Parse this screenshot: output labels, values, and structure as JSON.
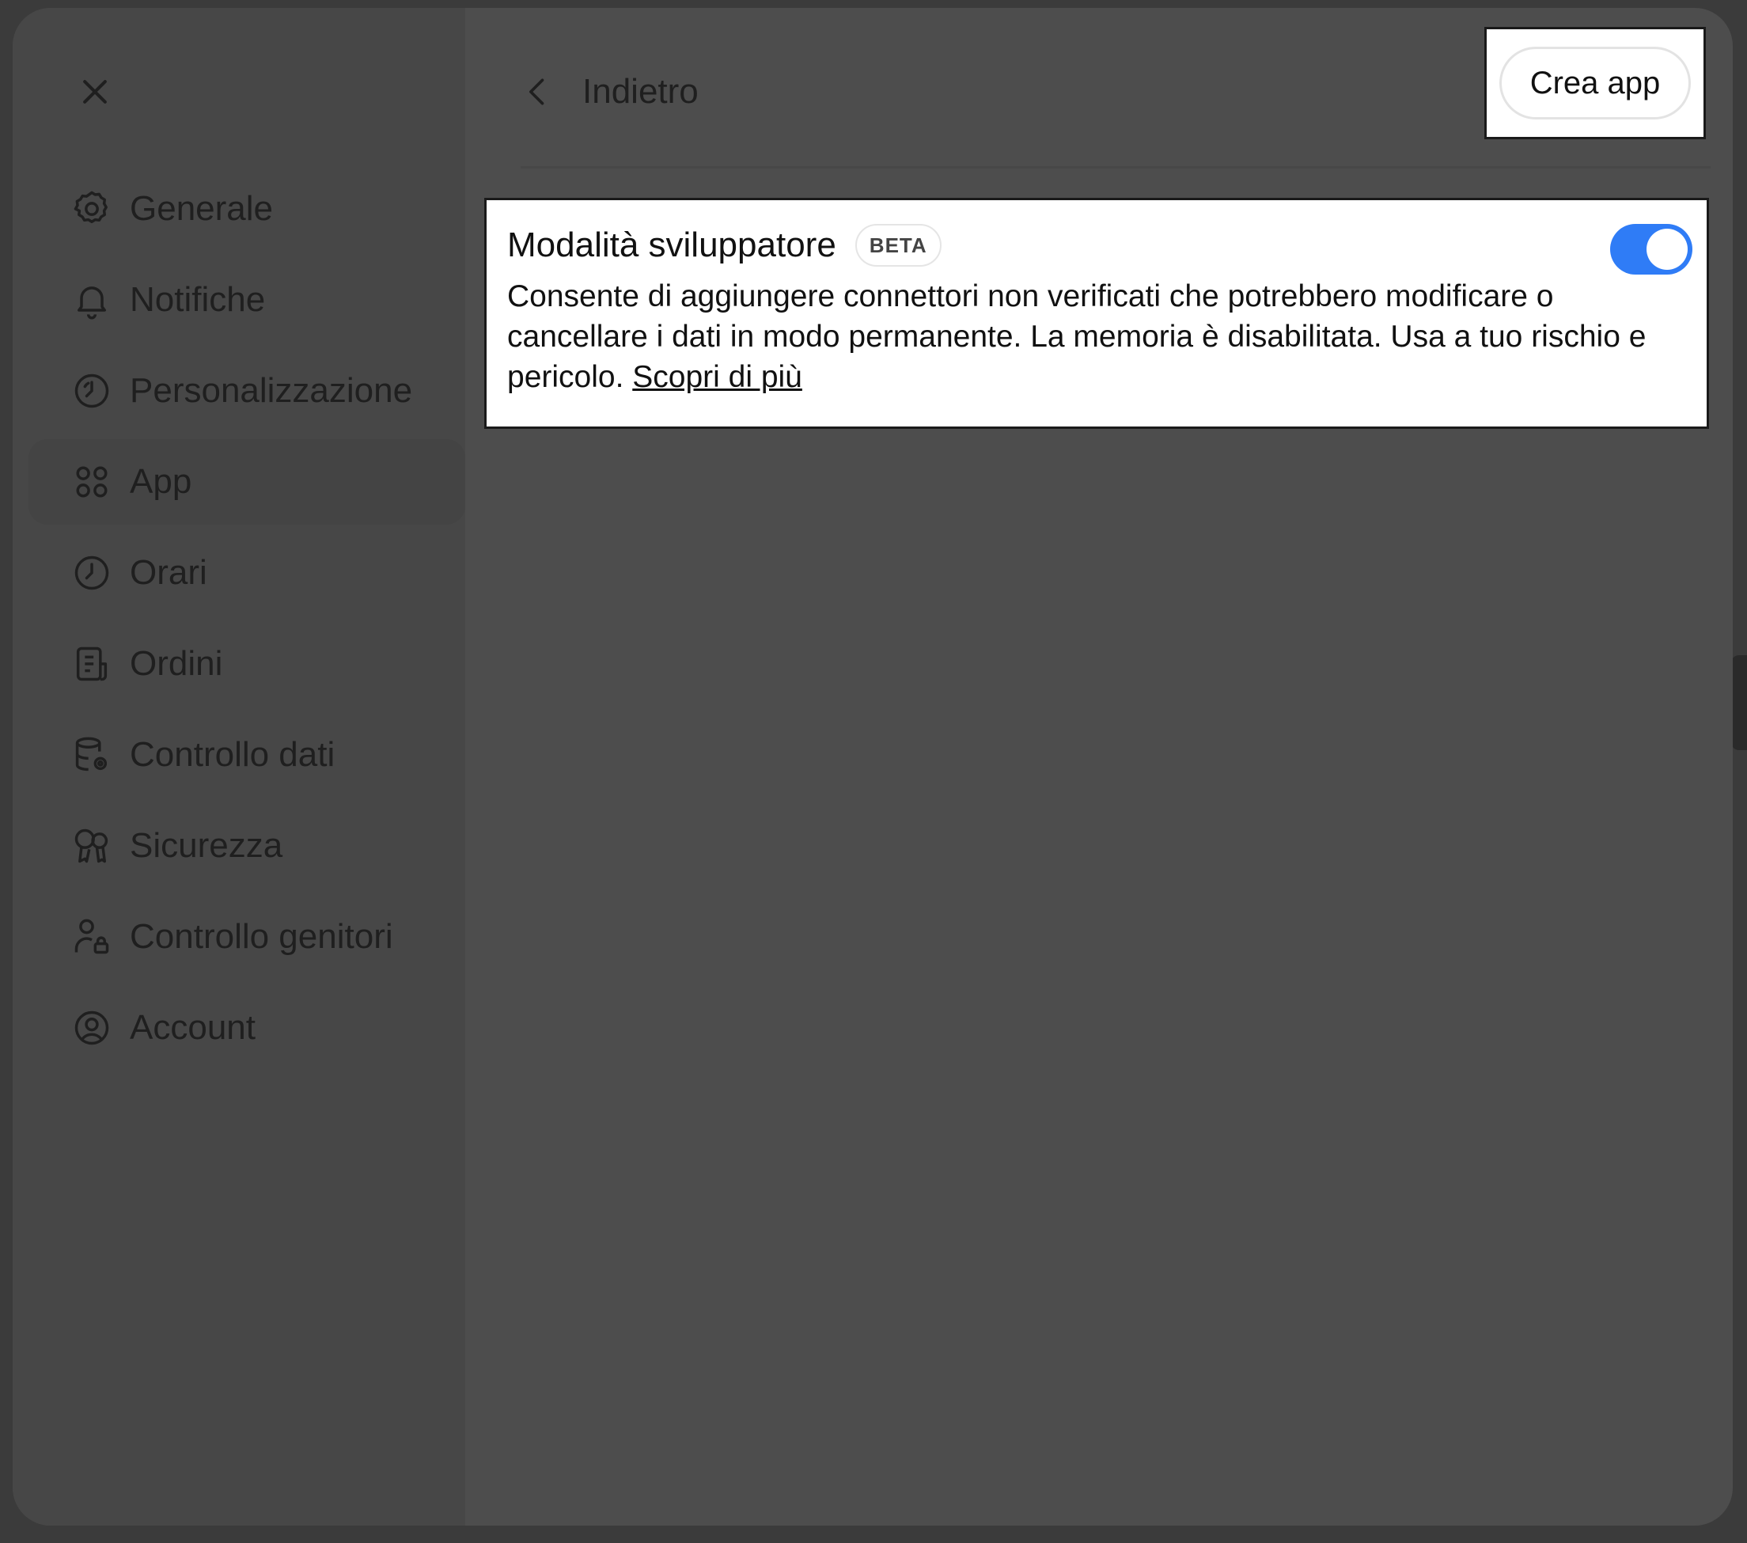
{
  "header": {
    "back_label": "Indietro",
    "create_button_label": "Crea app"
  },
  "sidebar": {
    "items": [
      {
        "label": "Generale",
        "icon": "gear-icon",
        "active": false
      },
      {
        "label": "Notifiche",
        "icon": "bell-icon",
        "active": false
      },
      {
        "label": "Personalizzazione",
        "icon": "personalization-icon",
        "active": false
      },
      {
        "label": "App",
        "icon": "apps-grid-icon",
        "active": true
      },
      {
        "label": "Orari",
        "icon": "clock-icon",
        "active": false
      },
      {
        "label": "Ordini",
        "icon": "orders-icon",
        "active": false
      },
      {
        "label": "Controllo dati",
        "icon": "database-gear-icon",
        "active": false
      },
      {
        "label": "Sicurezza",
        "icon": "key-icon",
        "active": false
      },
      {
        "label": "Controllo genitori",
        "icon": "parental-lock-icon",
        "active": false
      },
      {
        "label": "Account",
        "icon": "account-icon",
        "active": false
      }
    ]
  },
  "developer_mode": {
    "title": "Modalità sviluppatore",
    "badge": "BETA",
    "enabled": true,
    "description": "Consente di aggiungere connettori non verificati che potrebbero modificare o cancellare i dati in modo permanente. La memoria è disabilitata. Usa a tuo rischio e pericolo.",
    "link_label": "Scopri di più"
  },
  "colors": {
    "toggle_on": "#2f7cf6",
    "overlay": "#4d4d4d",
    "highlight_bg": "#ffffff"
  }
}
